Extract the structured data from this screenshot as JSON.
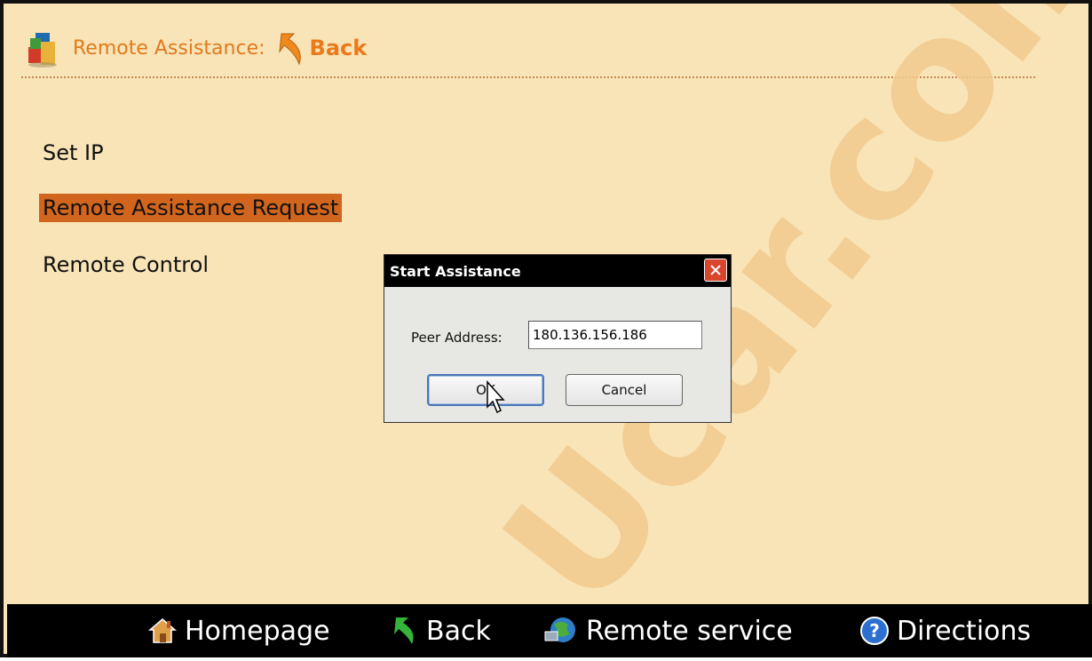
{
  "header": {
    "title": "Remote Assistance:",
    "back_label": "Back"
  },
  "menu": {
    "items": [
      {
        "label": "Set IP"
      },
      {
        "label": "Remote Assistance Request"
      },
      {
        "label": "Remote Control"
      }
    ],
    "selected_index": 1
  },
  "dialog": {
    "title": "Start Assistance",
    "peer_label": "Peer Address:",
    "peer_value": "180.136.156.186",
    "ok_label": "OK",
    "cancel_label": "Cancel"
  },
  "bottom_nav": {
    "homepage": "Homepage",
    "back": "Back",
    "remote_service": "Remote service",
    "directions": "Directions"
  },
  "watermark": {
    "text": "Ucar.com"
  },
  "colors": {
    "background": "#f8e4b6",
    "accent": "#ea7a1c",
    "selected_bg": "#d2651d",
    "bar": "#000000"
  },
  "icons": {
    "app": "blocks-icon",
    "back": "back-arrow-icon",
    "home": "house-icon",
    "remote": "globe-icon",
    "help": "question-icon",
    "close": "close-icon"
  }
}
